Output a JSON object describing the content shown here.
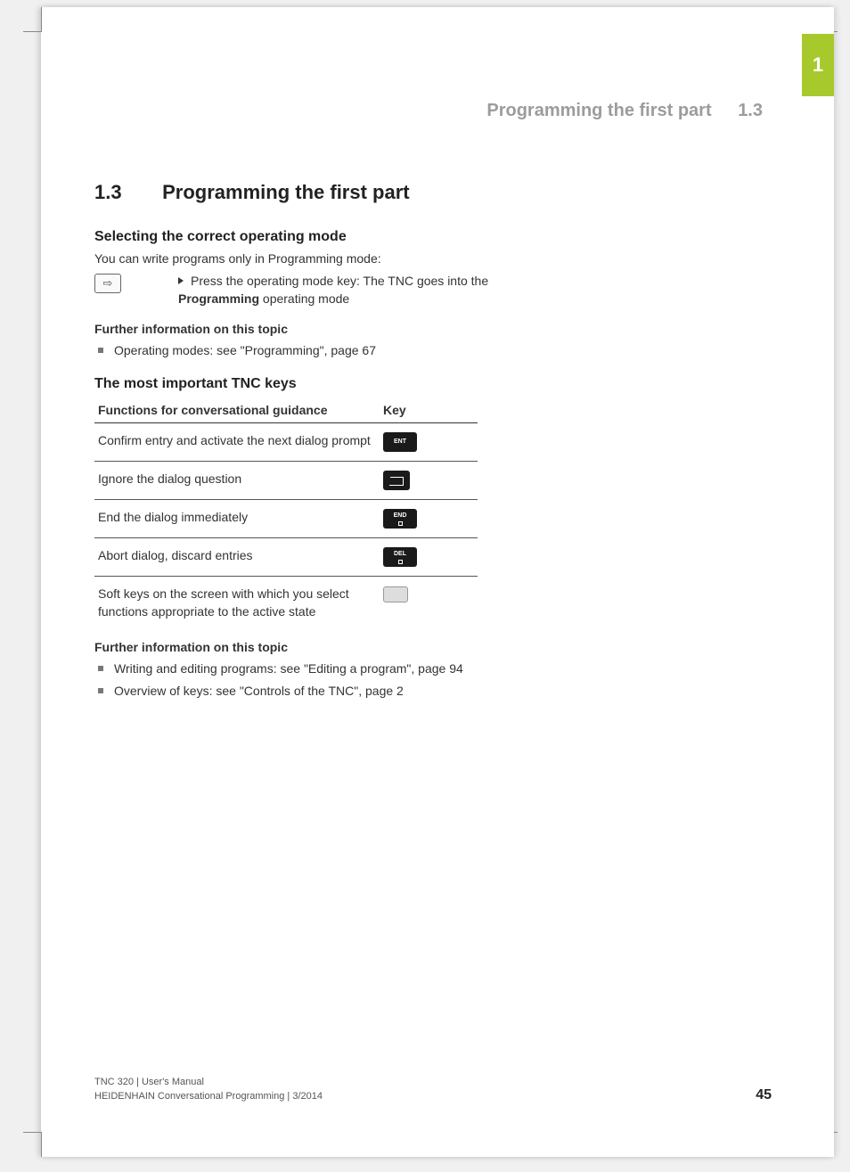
{
  "tab": {
    "chapter": "1"
  },
  "runningHead": {
    "title": "Programming the first part",
    "number": "1.3"
  },
  "h1": {
    "number": "1.3",
    "title": "Programming the first part"
  },
  "sec1": {
    "heading": "Selecting the correct operating mode",
    "intro": "You can write programs only in Programming mode:",
    "keyIcon": "⇨",
    "instr_pre": "Press the operating mode key: The TNC goes into the ",
    "instr_bold": "Programming",
    "instr_post": " operating mode",
    "furtherHeading": "Further information on this topic",
    "furtherItems": [
      "Operating modes: see \"Programming\", page 67"
    ]
  },
  "sec2": {
    "heading": "The most important TNC keys",
    "th1": "Functions for conversational guidance",
    "th2": "Key",
    "rows": [
      {
        "text": "Confirm entry and activate the next dialog prompt",
        "key": "ENT"
      },
      {
        "text": "Ignore the dialog question",
        "key": "NOENT"
      },
      {
        "text": "End the dialog immediately",
        "key": "END"
      },
      {
        "text": "Abort dialog, discard entries",
        "key": "DEL"
      },
      {
        "text": "Soft keys on the screen with which you select functions appropriate to the active state",
        "key": "SOFT"
      }
    ],
    "furtherHeading": "Further information on this topic",
    "furtherItems": [
      "Writing and editing programs: see \"Editing a program\", page 94",
      "Overview of keys: see \"Controls of the TNC\", page 2"
    ]
  },
  "footer": {
    "line1": "TNC 320 | User's Manual",
    "line2": "HEIDENHAIN Conversational Programming | 3/2014",
    "page": "45"
  }
}
